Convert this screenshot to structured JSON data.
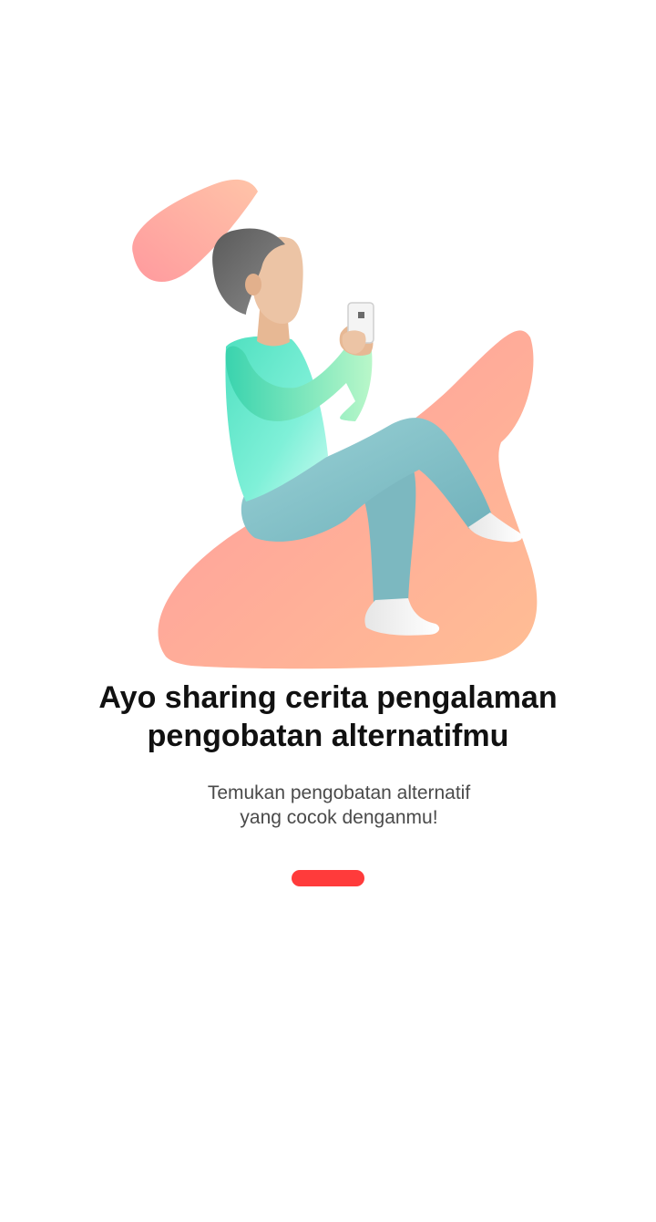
{
  "onboarding": {
    "title_line1": "Ayo sharing cerita pengalaman",
    "title_line2": "pengobatan alternatifmu",
    "subtitle_line1": "Temukan pengobatan alternatif",
    "subtitle_line2": "yang cocok denganmu!",
    "illustration_icon": "person-using-phone-illustration",
    "pager_active_color": "#ff3b3b"
  },
  "colors": {
    "blob_start": "#ff9a9e",
    "blob_end": "#ffbe94",
    "shirt": "#5fe6c8",
    "pants": "#8cc5cc",
    "skin": "#ecc4a5",
    "hair": "#6b6b6b"
  }
}
